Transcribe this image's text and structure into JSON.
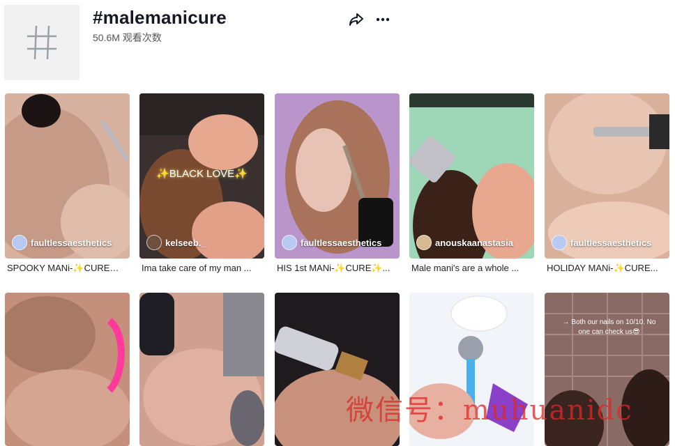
{
  "header": {
    "hashtag": "#malemanicure",
    "views": "50.6M 观看次数",
    "hash_glyph": "#"
  },
  "videos_row1": [
    {
      "author": "faultlessaesthetics",
      "caption": "SPOOKY MANi-✨CURE✨ ...",
      "colors": [
        "#c9a08a",
        "#5a4038"
      ]
    },
    {
      "author": "kelseeb._",
      "caption": "Ima take care of my man ...",
      "overlay": "✨BLACK LOVE✨",
      "colors": [
        "#8a5a3c",
        "#3a2a22"
      ]
    },
    {
      "author": "faultlessaesthetics",
      "caption": "HIS 1st MANi-✨CURE✨...",
      "colors": [
        "#c9a4d8",
        "#a06f58"
      ]
    },
    {
      "author": "anouskaanastasia",
      "caption": "Male mani's are a whole ...",
      "colors": [
        "#9fd6b8",
        "#5a3a2a"
      ]
    },
    {
      "author": "faultlessaesthetics",
      "caption": "HOLIDAY MANi-✨CURE...",
      "colors": [
        "#e4c0aa",
        "#b48870"
      ]
    }
  ],
  "videos_row2": [
    {
      "colors": [
        "#c59080",
        "#e03a8c"
      ]
    },
    {
      "colors": [
        "#d9a899",
        "#2a2a30"
      ]
    },
    {
      "colors": [
        "#c58c7a",
        "#3a3440"
      ]
    },
    {
      "colors": [
        "#e8eef5",
        "#4aa8e8"
      ]
    },
    {
      "overlay": "→ Both our nails on 10/10. No one can check us😎",
      "colors": [
        "#a5706a",
        "#4a2e28"
      ]
    }
  ],
  "watermark": "微信号：muhuanidc"
}
